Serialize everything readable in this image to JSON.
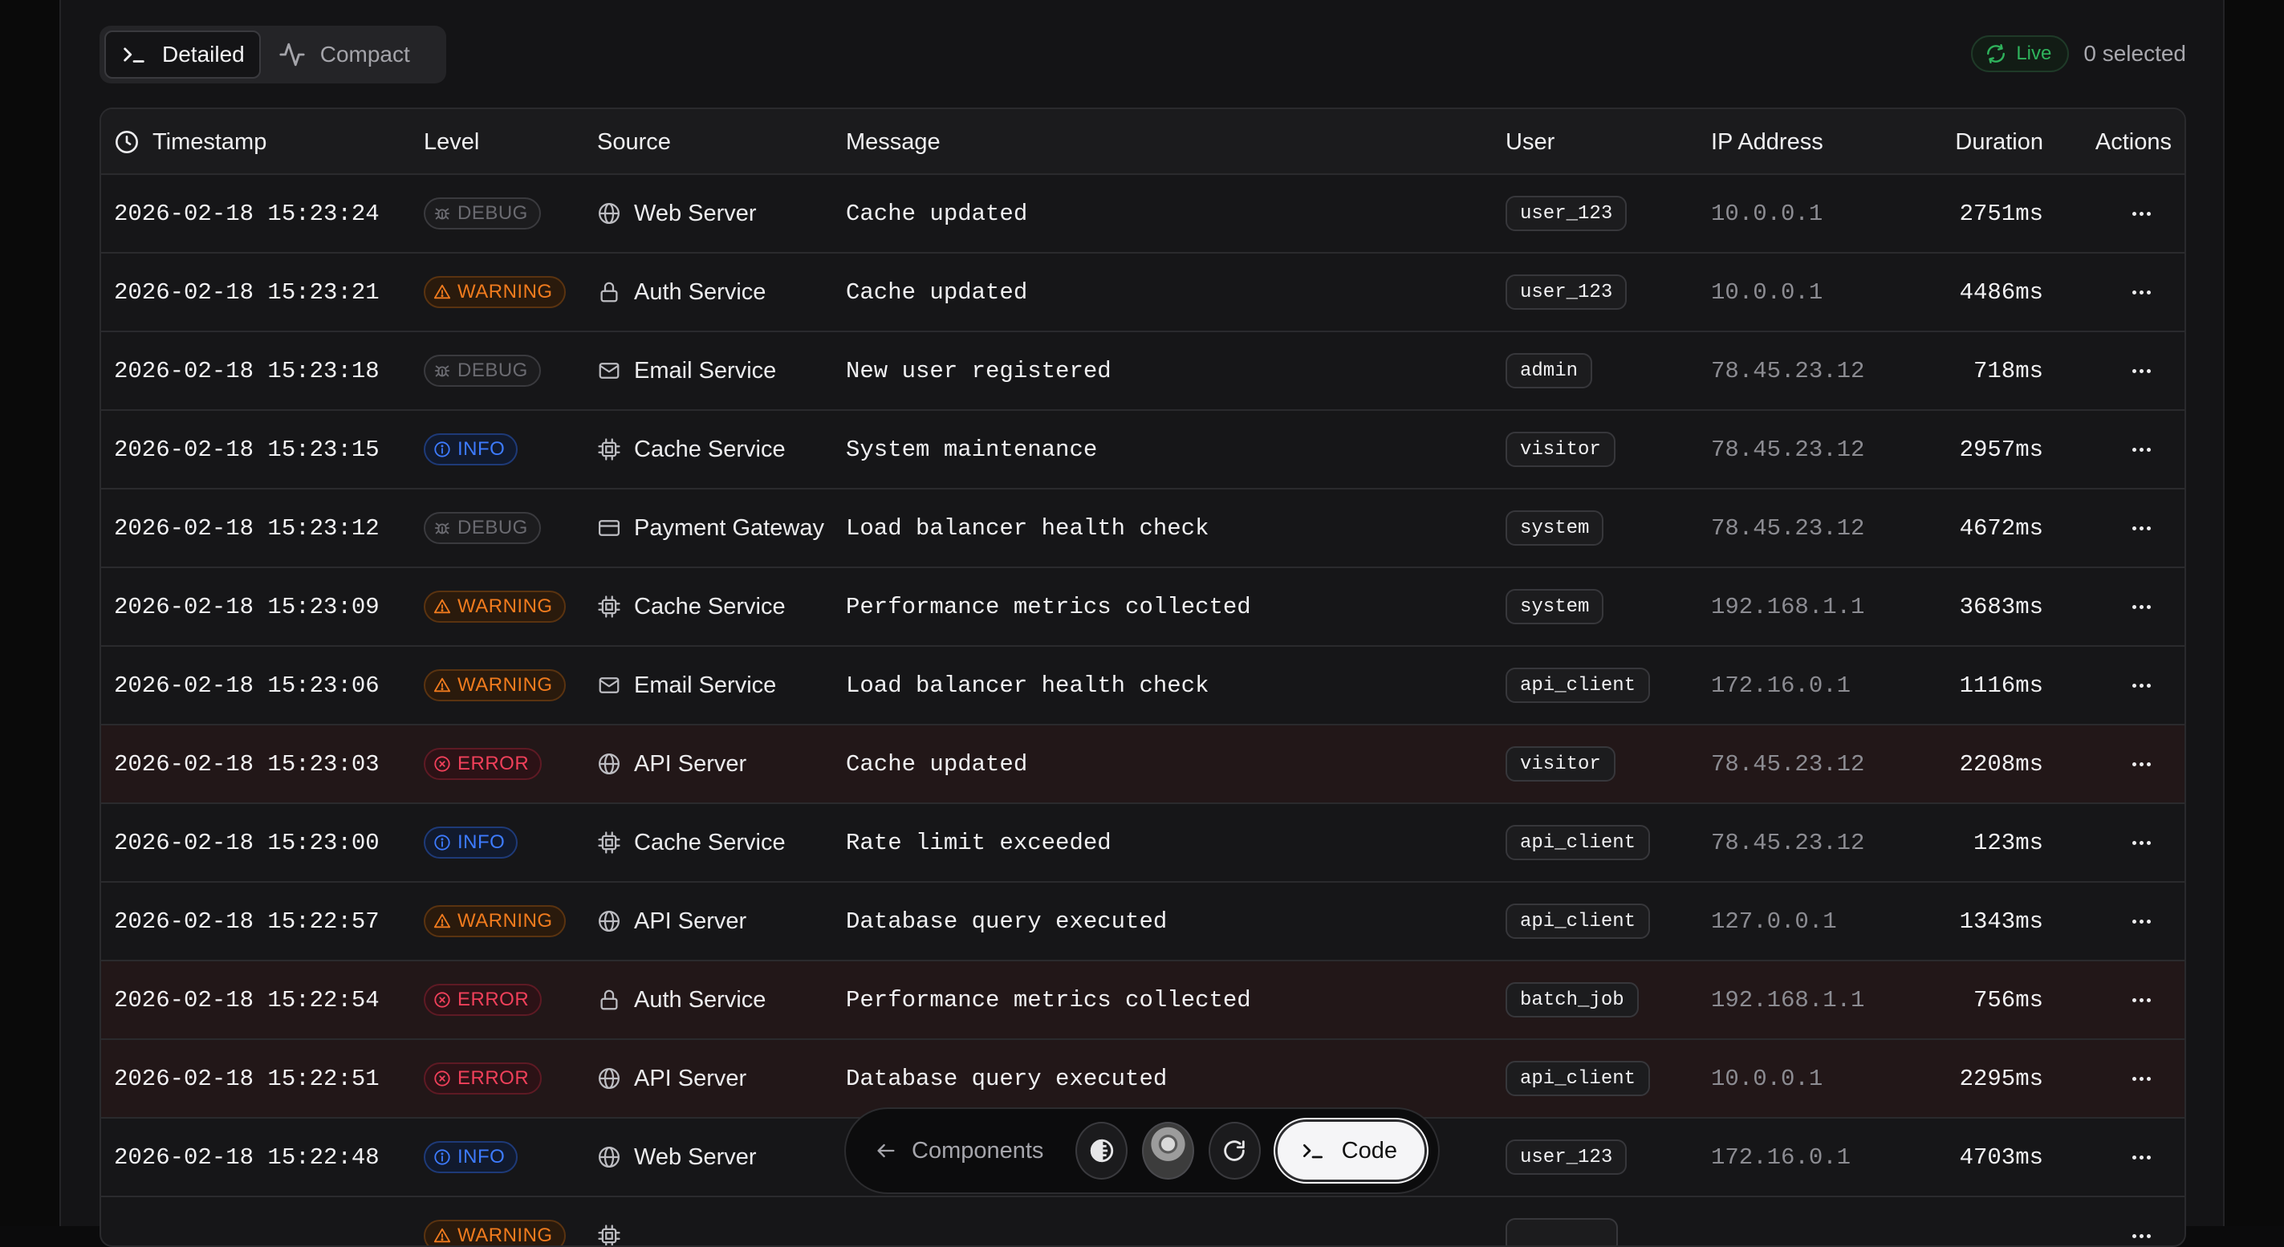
{
  "toolbar": {
    "views": [
      {
        "label": "Detailed",
        "icon": "terminal-icon",
        "active": true
      },
      {
        "label": "Compact",
        "icon": "activity-icon",
        "active": false
      }
    ],
    "live_label": "Live",
    "selected_text": "0 selected"
  },
  "table": {
    "headers": {
      "timestamp": "Timestamp",
      "level": "Level",
      "source": "Source",
      "message": "Message",
      "user": "User",
      "ip": "IP Address",
      "duration": "Duration",
      "actions": "Actions"
    },
    "rows": [
      {
        "timestamp": "2026-02-18 15:23:24",
        "level": "DEBUG",
        "source": "Web Server",
        "source_icon": "globe-icon",
        "message": "Cache updated",
        "user": "user_123",
        "ip": "10.0.0.1",
        "duration": "2751ms"
      },
      {
        "timestamp": "2026-02-18 15:23:21",
        "level": "WARNING",
        "source": "Auth Service",
        "source_icon": "lock-icon",
        "message": "Cache updated",
        "user": "user_123",
        "ip": "10.0.0.1",
        "duration": "4486ms"
      },
      {
        "timestamp": "2026-02-18 15:23:18",
        "level": "DEBUG",
        "source": "Email Service",
        "source_icon": "mail-icon",
        "message": "New user registered",
        "user": "admin",
        "ip": "78.45.23.12",
        "duration": "718ms"
      },
      {
        "timestamp": "2026-02-18 15:23:15",
        "level": "INFO",
        "source": "Cache Service",
        "source_icon": "cpu-icon",
        "message": "System maintenance",
        "user": "visitor",
        "ip": "78.45.23.12",
        "duration": "2957ms"
      },
      {
        "timestamp": "2026-02-18 15:23:12",
        "level": "DEBUG",
        "source": "Payment Gateway",
        "source_icon": "credit-card-icon",
        "message": "Load balancer health check",
        "user": "system",
        "ip": "78.45.23.12",
        "duration": "4672ms"
      },
      {
        "timestamp": "2026-02-18 15:23:09",
        "level": "WARNING",
        "source": "Cache Service",
        "source_icon": "cpu-icon",
        "message": "Performance metrics collected",
        "user": "system",
        "ip": "192.168.1.1",
        "duration": "3683ms"
      },
      {
        "timestamp": "2026-02-18 15:23:06",
        "level": "WARNING",
        "source": "Email Service",
        "source_icon": "mail-icon",
        "message": "Load balancer health check",
        "user": "api_client",
        "ip": "172.16.0.1",
        "duration": "1116ms"
      },
      {
        "timestamp": "2026-02-18 15:23:03",
        "level": "ERROR",
        "source": "API Server",
        "source_icon": "globe-icon",
        "message": "Cache updated",
        "user": "visitor",
        "ip": "78.45.23.12",
        "duration": "2208ms"
      },
      {
        "timestamp": "2026-02-18 15:23:00",
        "level": "INFO",
        "source": "Cache Service",
        "source_icon": "cpu-icon",
        "message": "Rate limit exceeded",
        "user": "api_client",
        "ip": "78.45.23.12",
        "duration": "123ms"
      },
      {
        "timestamp": "2026-02-18 15:22:57",
        "level": "WARNING",
        "source": "API Server",
        "source_icon": "globe-icon",
        "message": "Database query executed",
        "user": "api_client",
        "ip": "127.0.0.1",
        "duration": "1343ms"
      },
      {
        "timestamp": "2026-02-18 15:22:54",
        "level": "ERROR",
        "source": "Auth Service",
        "source_icon": "lock-icon",
        "message": "Performance metrics collected",
        "user": "batch_job",
        "ip": "192.168.1.1",
        "duration": "756ms"
      },
      {
        "timestamp": "2026-02-18 15:22:51",
        "level": "ERROR",
        "source": "API Server",
        "source_icon": "globe-icon",
        "message": "Database query executed",
        "user": "api_client",
        "ip": "10.0.0.1",
        "duration": "2295ms"
      },
      {
        "timestamp": "2026-02-18 15:22:48",
        "level": "INFO",
        "source": "Web Server",
        "source_icon": "globe-icon",
        "message": "",
        "user": "user_123",
        "ip": "172.16.0.1",
        "duration": "4703ms"
      },
      {
        "timestamp": "",
        "level": "WARNING",
        "source": "",
        "source_icon": "cpu-icon",
        "message": "",
        "user": "",
        "ip": "",
        "duration": ""
      }
    ]
  },
  "dock": {
    "back_label": "Components",
    "code_label": "Code"
  },
  "colors": {
    "debug": "#6a6a70",
    "warning": "#f07b1e",
    "info": "#3d7bff",
    "error": "#f0405a",
    "live": "#2fb35c"
  }
}
